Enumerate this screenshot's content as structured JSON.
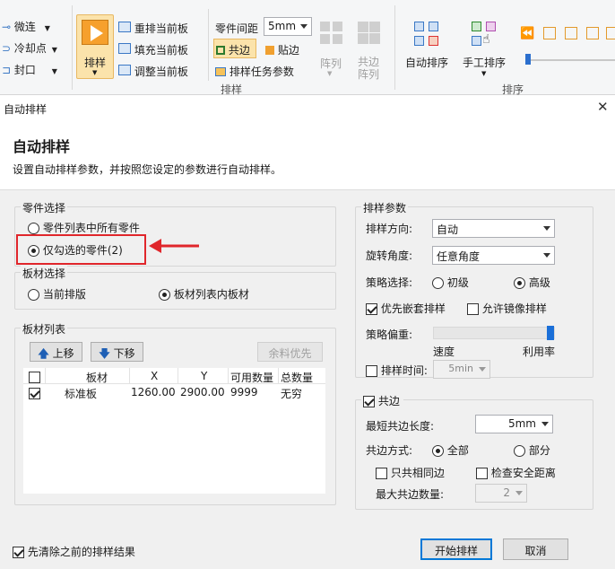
{
  "ribbon": {
    "left_items": [
      {
        "label": "微连"
      },
      {
        "label": "冷却点"
      },
      {
        "label": "封口"
      }
    ],
    "nest_button": "排样",
    "nest_menu": [
      {
        "label": "重排当前板"
      },
      {
        "label": "填充当前板"
      },
      {
        "label": "调整当前板"
      }
    ],
    "part_spacing_label": "零件间距",
    "part_spacing_value": "5mm",
    "common_edge_label": "共边",
    "paste_label": "贴边",
    "task_params_label": "排样任务参数",
    "array_label": "阵列",
    "common_array_label_1": "共边",
    "common_array_label_2": "阵列",
    "group1_label": "排样",
    "auto_nest_label": "自动排序",
    "manual_nest_label": "手工排序",
    "group2_label": "排序"
  },
  "dialog": {
    "window_title": "自动排样",
    "heading": "自动排样",
    "description": "设置自动排样参数，并按照您设定的参数进行自动排样。",
    "part_selection": {
      "title": "零件选择",
      "option_all": "零件列表中所有零件",
      "option_checked": "仅勾选的零件(2)",
      "selected": "option_checked"
    },
    "sheet_selection": {
      "title": "板材选择",
      "option_current": "当前排版",
      "option_list": "板材列表内板材",
      "selected": "option_list"
    },
    "sheet_list": {
      "title": "板材列表",
      "move_up": "上移",
      "move_down": "下移",
      "remnant_first": "余料优先",
      "columns": [
        "板材",
        "X",
        "Y",
        "可用数量",
        "总数量"
      ],
      "rows": [
        {
          "checked": true,
          "name": "标准板",
          "x": "1260.00",
          "y": "2900.00",
          "available": "9999",
          "total": "无穷"
        }
      ]
    },
    "nest_params": {
      "title": "排样参数",
      "direction_label": "排样方向:",
      "direction_value": "自动",
      "rotation_label": "旋转角度:",
      "rotation_value": "任意角度",
      "strategy_label": "策略选择:",
      "strategy_basic": "初级",
      "strategy_advanced": "高级",
      "strategy_selected": "advanced",
      "prefer_nesting_label": "优先嵌套排样",
      "prefer_nesting_checked": true,
      "allow_mirror_label": "允许镜像排样",
      "allow_mirror_checked": false,
      "bias_label": "策略偏重:",
      "bias_left": "速度",
      "bias_right": "利用率",
      "bias_value": 1.0,
      "time_label": "排样时间:",
      "time_checked": false,
      "time_value": "5min"
    },
    "common_edge": {
      "title": "共边",
      "checked": true,
      "min_length_label": "最短共边长度:",
      "min_length_value": "5mm",
      "mode_label": "共边方式:",
      "mode_all": "全部",
      "mode_partial": "部分",
      "mode_selected": "all",
      "same_only_label": "只共相同边",
      "same_only_checked": false,
      "check_safe_label": "检查安全距离",
      "check_safe_checked": false,
      "max_count_label": "最大共边数量:",
      "max_count_value": "2"
    },
    "clear_previous_label": "先清除之前的排样结果",
    "clear_previous_checked": true,
    "start_button": "开始排样",
    "cancel_button": "取消"
  },
  "colors": {
    "highlight_red": "#e0262b",
    "accent_blue": "#0078d7",
    "ribbon_orange": "#f07c2c"
  }
}
